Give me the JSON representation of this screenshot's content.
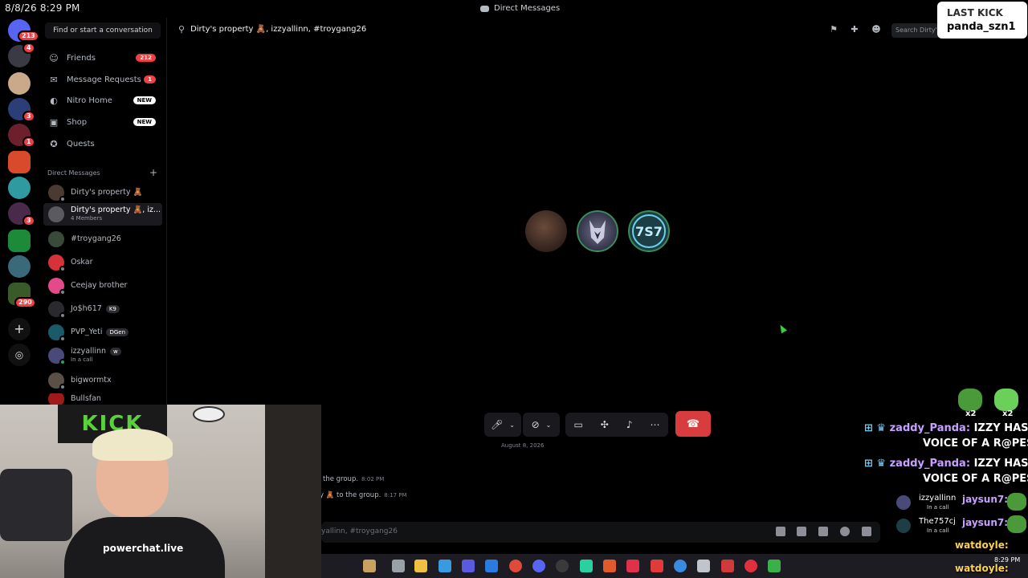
{
  "clock": "8/8/26 8:29 PM",
  "window": {
    "title": "Direct Messages"
  },
  "servers": {
    "home_badge": "213",
    "items": [
      {
        "color": "#5865f2",
        "badge": ""
      },
      {
        "color": "#3a3a44",
        "badge": "4"
      },
      {
        "color": "#caa88a",
        "badge": ""
      },
      {
        "color": "#2c3e78",
        "badge": "3"
      },
      {
        "color": "#6d1f2b",
        "badge": "1"
      },
      {
        "color": "#d84a2b",
        "badge": ""
      },
      {
        "color": "#2f9aa0",
        "badge": ""
      },
      {
        "color": "#4a2a4a",
        "badge": "3"
      },
      {
        "color": "#1d8a3a",
        "badge": ""
      },
      {
        "color": "#3a6a7a",
        "badge": ""
      },
      {
        "color": "#3a5a2a",
        "badge": "290"
      }
    ]
  },
  "sidebar": {
    "find_label": "Find or start a conversation",
    "nav": [
      {
        "label": "Friends",
        "badge": "212",
        "badge_type": "red"
      },
      {
        "label": "Message Requests",
        "badge": "1",
        "badge_type": "red"
      },
      {
        "label": "Nitro Home",
        "badge": "NEW",
        "badge_type": "blue"
      },
      {
        "label": "Shop",
        "badge": "NEW",
        "badge_type": "blue"
      },
      {
        "label": "Quests",
        "badge": "",
        "badge_type": ""
      }
    ],
    "dm_header": "Direct Messages",
    "dms": [
      {
        "name": "Dirty's property 🧸",
        "sub": "",
        "tag": "",
        "active": false
      },
      {
        "name": "Dirty's property 🧸, iz...",
        "sub": "4 Members",
        "tag": "",
        "active": true
      },
      {
        "name": "#troygang26",
        "sub": "",
        "tag": "",
        "active": false
      },
      {
        "name": "Oskar",
        "sub": "",
        "tag": "",
        "active": false
      },
      {
        "name": "Ceejay brother",
        "sub": "",
        "tag": "",
        "active": false
      },
      {
        "name": "Jo$h617",
        "sub": "",
        "tag": "K9",
        "active": false
      },
      {
        "name": "PVP_Yeti",
        "sub": "",
        "tag": "DGen",
        "active": false
      },
      {
        "name": "izzyallinn",
        "sub": "In a call",
        "tag": "w",
        "active": false
      },
      {
        "name": "bigwormtx",
        "sub": "",
        "tag": "",
        "active": false
      },
      {
        "name": "Bullsfan",
        "sub": "",
        "tag": "",
        "active": false
      }
    ]
  },
  "channel": {
    "title": "Dirty's property 🧸, izzyallinn, #troygang26",
    "search_placeholder": "Search Dirty's property"
  },
  "chat": {
    "date_divider": "August 8, 2026",
    "lines": [
      {
        "text": "the group.",
        "time": "8:02 PM"
      },
      {
        "text": "y 🧸 to the group.",
        "time": "8:17 PM"
      }
    ],
    "input_placeholder": "yallinn, #troygang26"
  },
  "overlay": {
    "kick_title": "LAST KICK",
    "kick_user": "panda_szn1",
    "emote_counts": [
      "x2",
      "x2"
    ],
    "messages": [
      {
        "user": "zaddy_Panda:",
        "text1": "IZZY HAS A",
        "text2": "VOICE OF A R@PEST"
      },
      {
        "user": "zaddy_Panda:",
        "text1": "IZZY HAS A",
        "text2": "VOICE OF A R@PEST"
      }
    ],
    "call_rows": [
      {
        "name": "izzyallinn",
        "sub": "In a call",
        "chat_user": "jaysun7:"
      },
      {
        "name": "The757cj",
        "sub": "In a call",
        "chat_user": "jaysun7:"
      }
    ],
    "bottom_users": [
      "watdoyle:",
      "watdoyle:"
    ],
    "tray_time": "8:29 PM"
  },
  "webcam": {
    "banner": "KICK",
    "shirt_text": "powerchat.live"
  }
}
